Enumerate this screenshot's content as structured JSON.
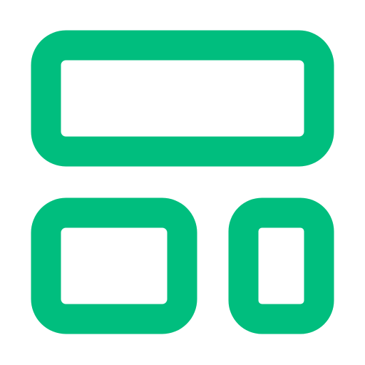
{
  "icon": {
    "name": "layout-dashboard-icon",
    "color": "#00BE7E",
    "background": "#FFFFFF"
  }
}
